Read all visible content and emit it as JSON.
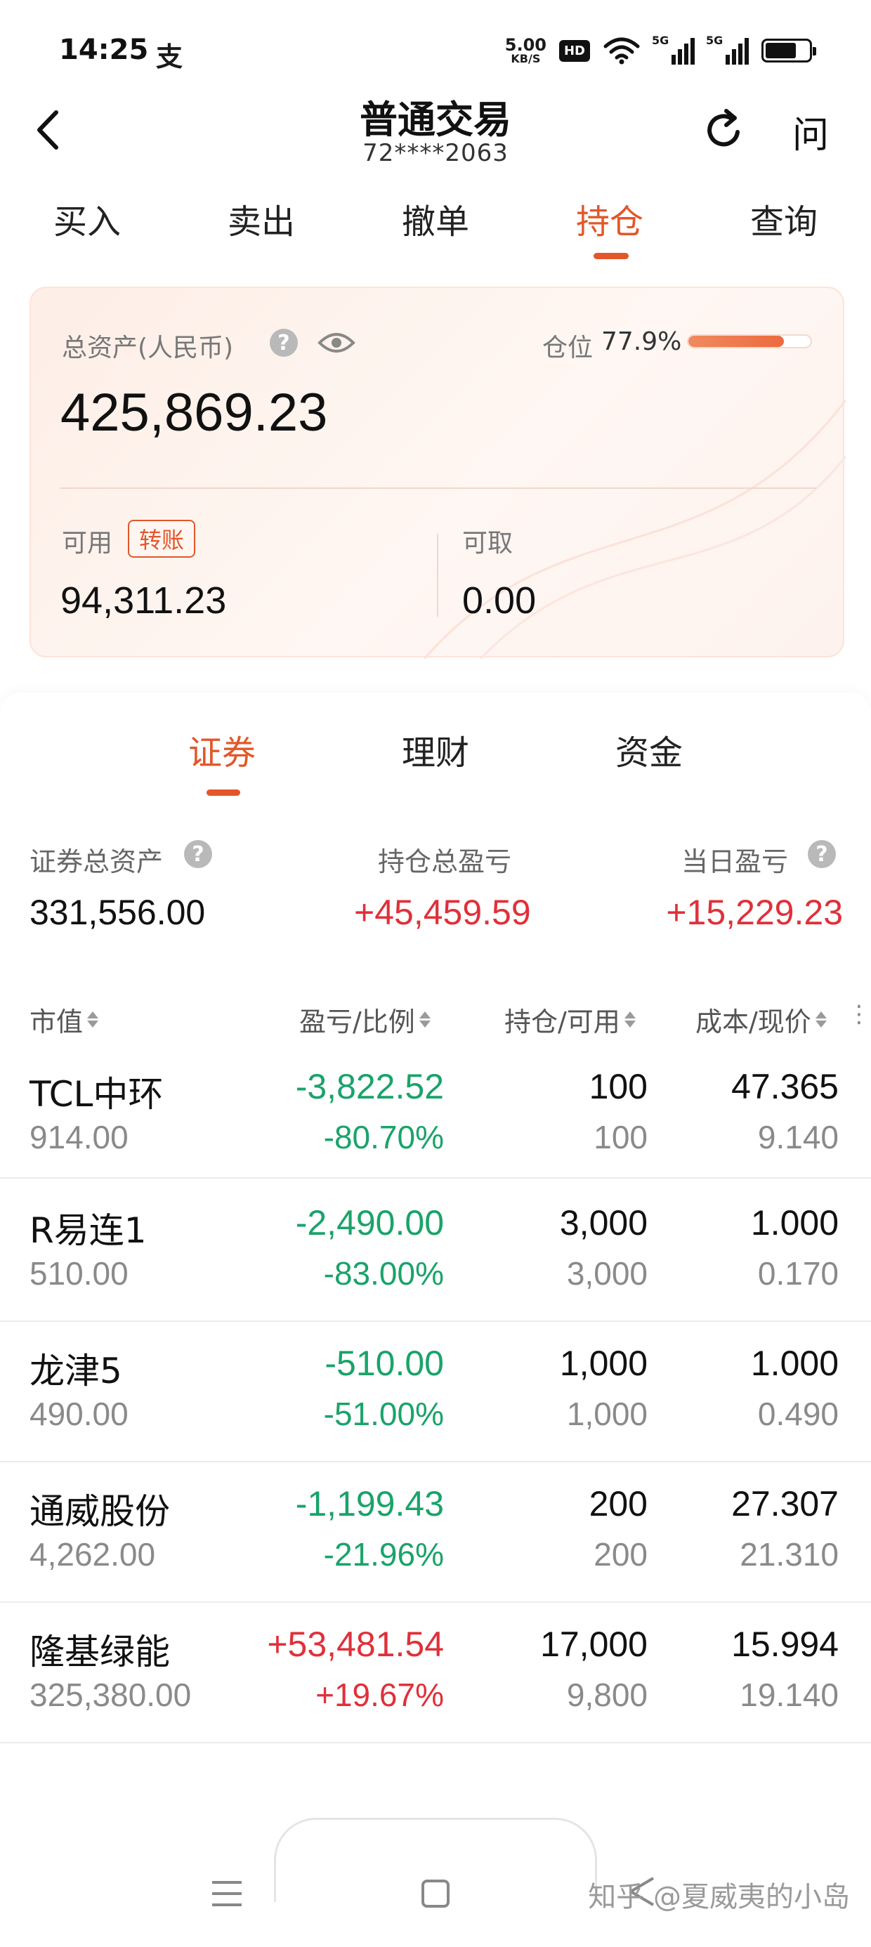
{
  "status": {
    "time": "14:25",
    "app_icon_glyph": "支",
    "net_speed_value": "5.00",
    "net_speed_unit": "KB/S",
    "hd_badge": "HD",
    "signal1_label": "5G",
    "signal2_label": "5G"
  },
  "header": {
    "title": "普通交易",
    "account": "72****2063",
    "ask_label": "问"
  },
  "top_tabs": [
    {
      "label": "买入"
    },
    {
      "label": "卖出"
    },
    {
      "label": "撤单"
    },
    {
      "label": "持仓",
      "active": true
    },
    {
      "label": "查询"
    }
  ],
  "asset_card": {
    "total_label": "总资产(人民币)",
    "help_glyph": "?",
    "total_value": "425,869.23",
    "position_label": "仓位",
    "position_value": "77.9%",
    "position_fraction": 0.779,
    "available_label": "可用",
    "transfer_label": "转账",
    "available_value": "94,311.23",
    "withdrawable_label": "可取",
    "withdrawable_value": "0.00"
  },
  "sub_tabs": [
    {
      "label": "证券",
      "active": true
    },
    {
      "label": "理财"
    },
    {
      "label": "资金"
    }
  ],
  "summary": {
    "securities_total_label": "证券总资产",
    "securities_total_value": "331,556.00",
    "holding_pnl_label": "持仓总盈亏",
    "holding_pnl_value": "+45,459.59",
    "daily_pnl_label": "当日盈亏",
    "daily_pnl_value": "+15,229.23"
  },
  "columns": {
    "market_value": "市值",
    "pnl_ratio": "盈亏/比例",
    "holding_available": "持仓/可用",
    "cost_price": "成本/现价"
  },
  "holdings": [
    {
      "name": "TCL中环",
      "market_value": "914.00",
      "pnl": "-3,822.52",
      "ratio": "-80.70%",
      "holding": "100",
      "available": "100",
      "cost": "47.365",
      "price": "9.140",
      "direction": "down"
    },
    {
      "name": "R易连1",
      "market_value": "510.00",
      "pnl": "-2,490.00",
      "ratio": "-83.00%",
      "holding": "3,000",
      "available": "3,000",
      "cost": "1.000",
      "price": "0.170",
      "direction": "down"
    },
    {
      "name": "龙津5",
      "market_value": "490.00",
      "pnl": "-510.00",
      "ratio": "-51.00%",
      "holding": "1,000",
      "available": "1,000",
      "cost": "1.000",
      "price": "0.490",
      "direction": "down"
    },
    {
      "name": "通威股份",
      "market_value": "4,262.00",
      "pnl": "-1,199.43",
      "ratio": "-21.96%",
      "holding": "200",
      "available": "200",
      "cost": "27.307",
      "price": "21.310",
      "direction": "down"
    },
    {
      "name": "隆基绿能",
      "market_value": "325,380.00",
      "pnl": "+53,481.54",
      "ratio": "+19.67%",
      "holding": "17,000",
      "available": "9,800",
      "cost": "15.994",
      "price": "19.140",
      "direction": "up"
    }
  ],
  "watermark": "知乎 @夏威夷的小岛",
  "colors": {
    "accent": "#e2572a",
    "up": "#e0303a",
    "down": "#1aa36a"
  }
}
